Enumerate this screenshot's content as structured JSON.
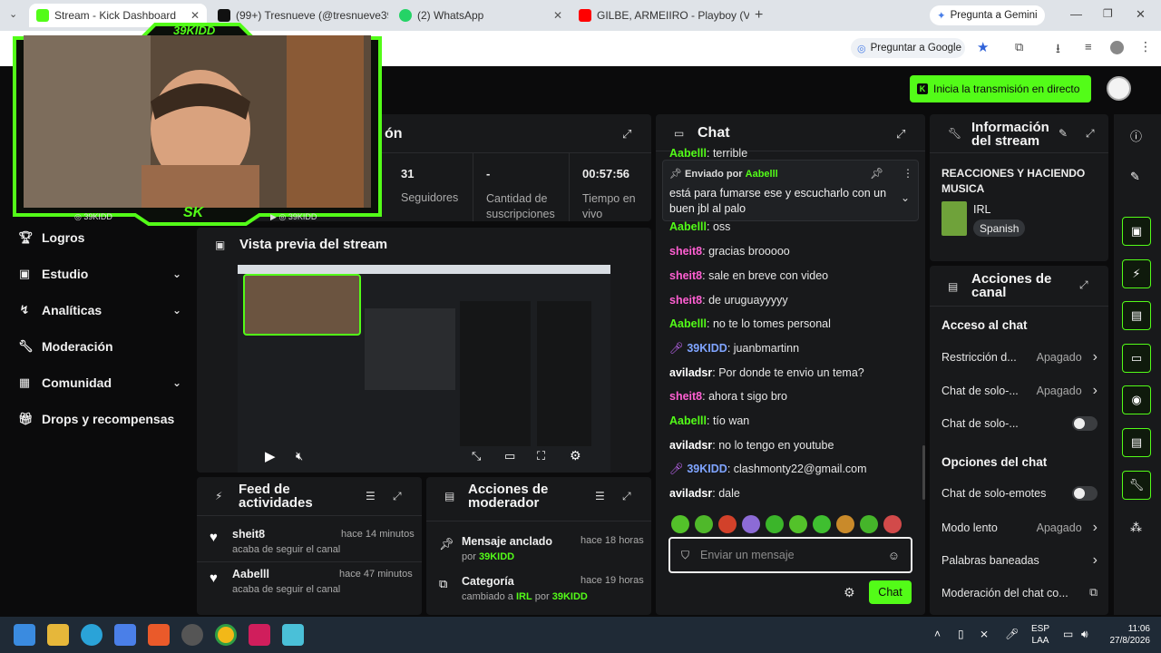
{
  "browser": {
    "tabs": [
      {
        "title": "Stream - Kick Dashboard",
        "active": true,
        "favicon_color": "#53fc18"
      },
      {
        "title": "(99+) Tresnueve (@tresnueve39",
        "active": false,
        "favicon_color": "#111111"
      },
      {
        "title": "(2) WhatsApp",
        "active": false,
        "favicon_color": "#25d366"
      },
      {
        "title": "GILBE, ARMEIIRO - Playboy (Vi",
        "active": false,
        "favicon_color": "#ff0000"
      }
    ],
    "gemini_label": "Pregunta a Gemini",
    "google_label": "Preguntar a Google"
  },
  "header": {
    "go_live": "Inicia la transmisión en directo"
  },
  "webcam": {
    "brand": "39KIDD",
    "handle_left": "39KIDD",
    "handle_right": "39KIDD",
    "logo": "SK"
  },
  "sidebar": {
    "items": [
      {
        "label": "Logros",
        "chevron": false
      },
      {
        "label": "Estudio",
        "chevron": true
      },
      {
        "label": "Analíticas",
        "chevron": true
      },
      {
        "label": "Moderación",
        "chevron": false
      },
      {
        "label": "Comunidad",
        "chevron": true
      },
      {
        "label": "Drops y recompensas",
        "chevron": false
      }
    ]
  },
  "session": {
    "title_partial": "ón",
    "stats": [
      {
        "value": "31",
        "label": "Seguidores"
      },
      {
        "value": "-",
        "label": "Cantidad de suscripciones"
      },
      {
        "value": "00:57:56",
        "label": "Tiempo en vivo"
      }
    ]
  },
  "preview": {
    "title": "Vista previa del stream"
  },
  "feed": {
    "title": "Feed de actividades",
    "items": [
      {
        "user": "sheit8",
        "time": "hace 14 minutos",
        "text": "acaba de seguir el canal"
      },
      {
        "user": "Aabelll",
        "time": "hace 47 minutos",
        "text": "acaba de seguir el canal"
      }
    ]
  },
  "modactions": {
    "title": "Acciones de moderador",
    "items": [
      {
        "title": "Mensaje anclado",
        "time": "hace 18 horas",
        "pre": "por",
        "user": "39KIDD"
      },
      {
        "title": "Categoría",
        "time": "hace 19 horas",
        "pre": "cambiado a",
        "cat": "IRL",
        "mid": "por",
        "user": "39KIDD"
      }
    ]
  },
  "chat": {
    "title": "Chat",
    "top_partial": {
      "user": "Aabelll",
      "text": "terrible"
    },
    "pinned": {
      "label": "Enviado por",
      "user": "Aabelll",
      "text": "está para fumarse ese y escucharlo con un buen jbl al palo"
    },
    "messages": [
      {
        "user": "Aabelll",
        "text": "oss",
        "color": "green"
      },
      {
        "user": "sheit8",
        "text": "gracias brooooo",
        "color": "pink"
      },
      {
        "user": "sheit8",
        "text": "sale en breve con video",
        "color": "pink"
      },
      {
        "user": "sheit8",
        "text": "de uruguayyyyy",
        "color": "pink"
      },
      {
        "user": "Aabelll",
        "text": "no te lo tomes personal",
        "color": "green"
      },
      {
        "user": "39KIDD",
        "text": "juanbmartinn",
        "color": "blue",
        "mic": true
      },
      {
        "user": "aviladsr",
        "text": "Por donde te envio un tema?",
        "color": "white"
      },
      {
        "user": "sheit8",
        "text": "ahora t sigo bro",
        "color": "pink"
      },
      {
        "user": "Aabelll",
        "text": "tío wan",
        "color": "green"
      },
      {
        "user": "aviladsr",
        "text": "no lo tengo en youtube",
        "color": "white"
      },
      {
        "user": "39KIDD",
        "text": "clashmonty22@gmail.com",
        "color": "blue",
        "mic": true
      },
      {
        "user": "aviladsr",
        "text": "dale",
        "color": "white"
      }
    ],
    "placeholder": "Enviar un mensaje",
    "send_label": "Chat"
  },
  "streaminfo": {
    "title_line1": "Información",
    "title_line2": "del stream",
    "stream_title": "REACCIONES Y HACIENDO MUSICA",
    "category": "IRL",
    "language": "Spanish"
  },
  "channel": {
    "title_line1": "Acciones de",
    "title_line2": "canal",
    "section1": "Acceso al chat",
    "rows1": [
      {
        "label": "Restricción d...",
        "value": "Apagado",
        "kind": "chevron"
      },
      {
        "label": "Chat de solo-...",
        "value": "Apagado",
        "kind": "chevron"
      },
      {
        "label": "Chat de solo-...",
        "value": "",
        "kind": "toggle"
      }
    ],
    "section2": "Opciones del chat",
    "rows2": [
      {
        "label": "Chat de solo-emotes",
        "value": "",
        "kind": "toggle"
      },
      {
        "label": "Modo lento",
        "value": "Apagado",
        "kind": "chevron"
      },
      {
        "label": "Palabras baneadas",
        "value": "",
        "kind": "chevron"
      },
      {
        "label": "Moderación del chat co...",
        "value": "",
        "kind": "external"
      }
    ]
  },
  "taskbar": {
    "lang1": "ESP",
    "lang2": "LAA",
    "time": "11:06",
    "date": "27/8/2026"
  }
}
